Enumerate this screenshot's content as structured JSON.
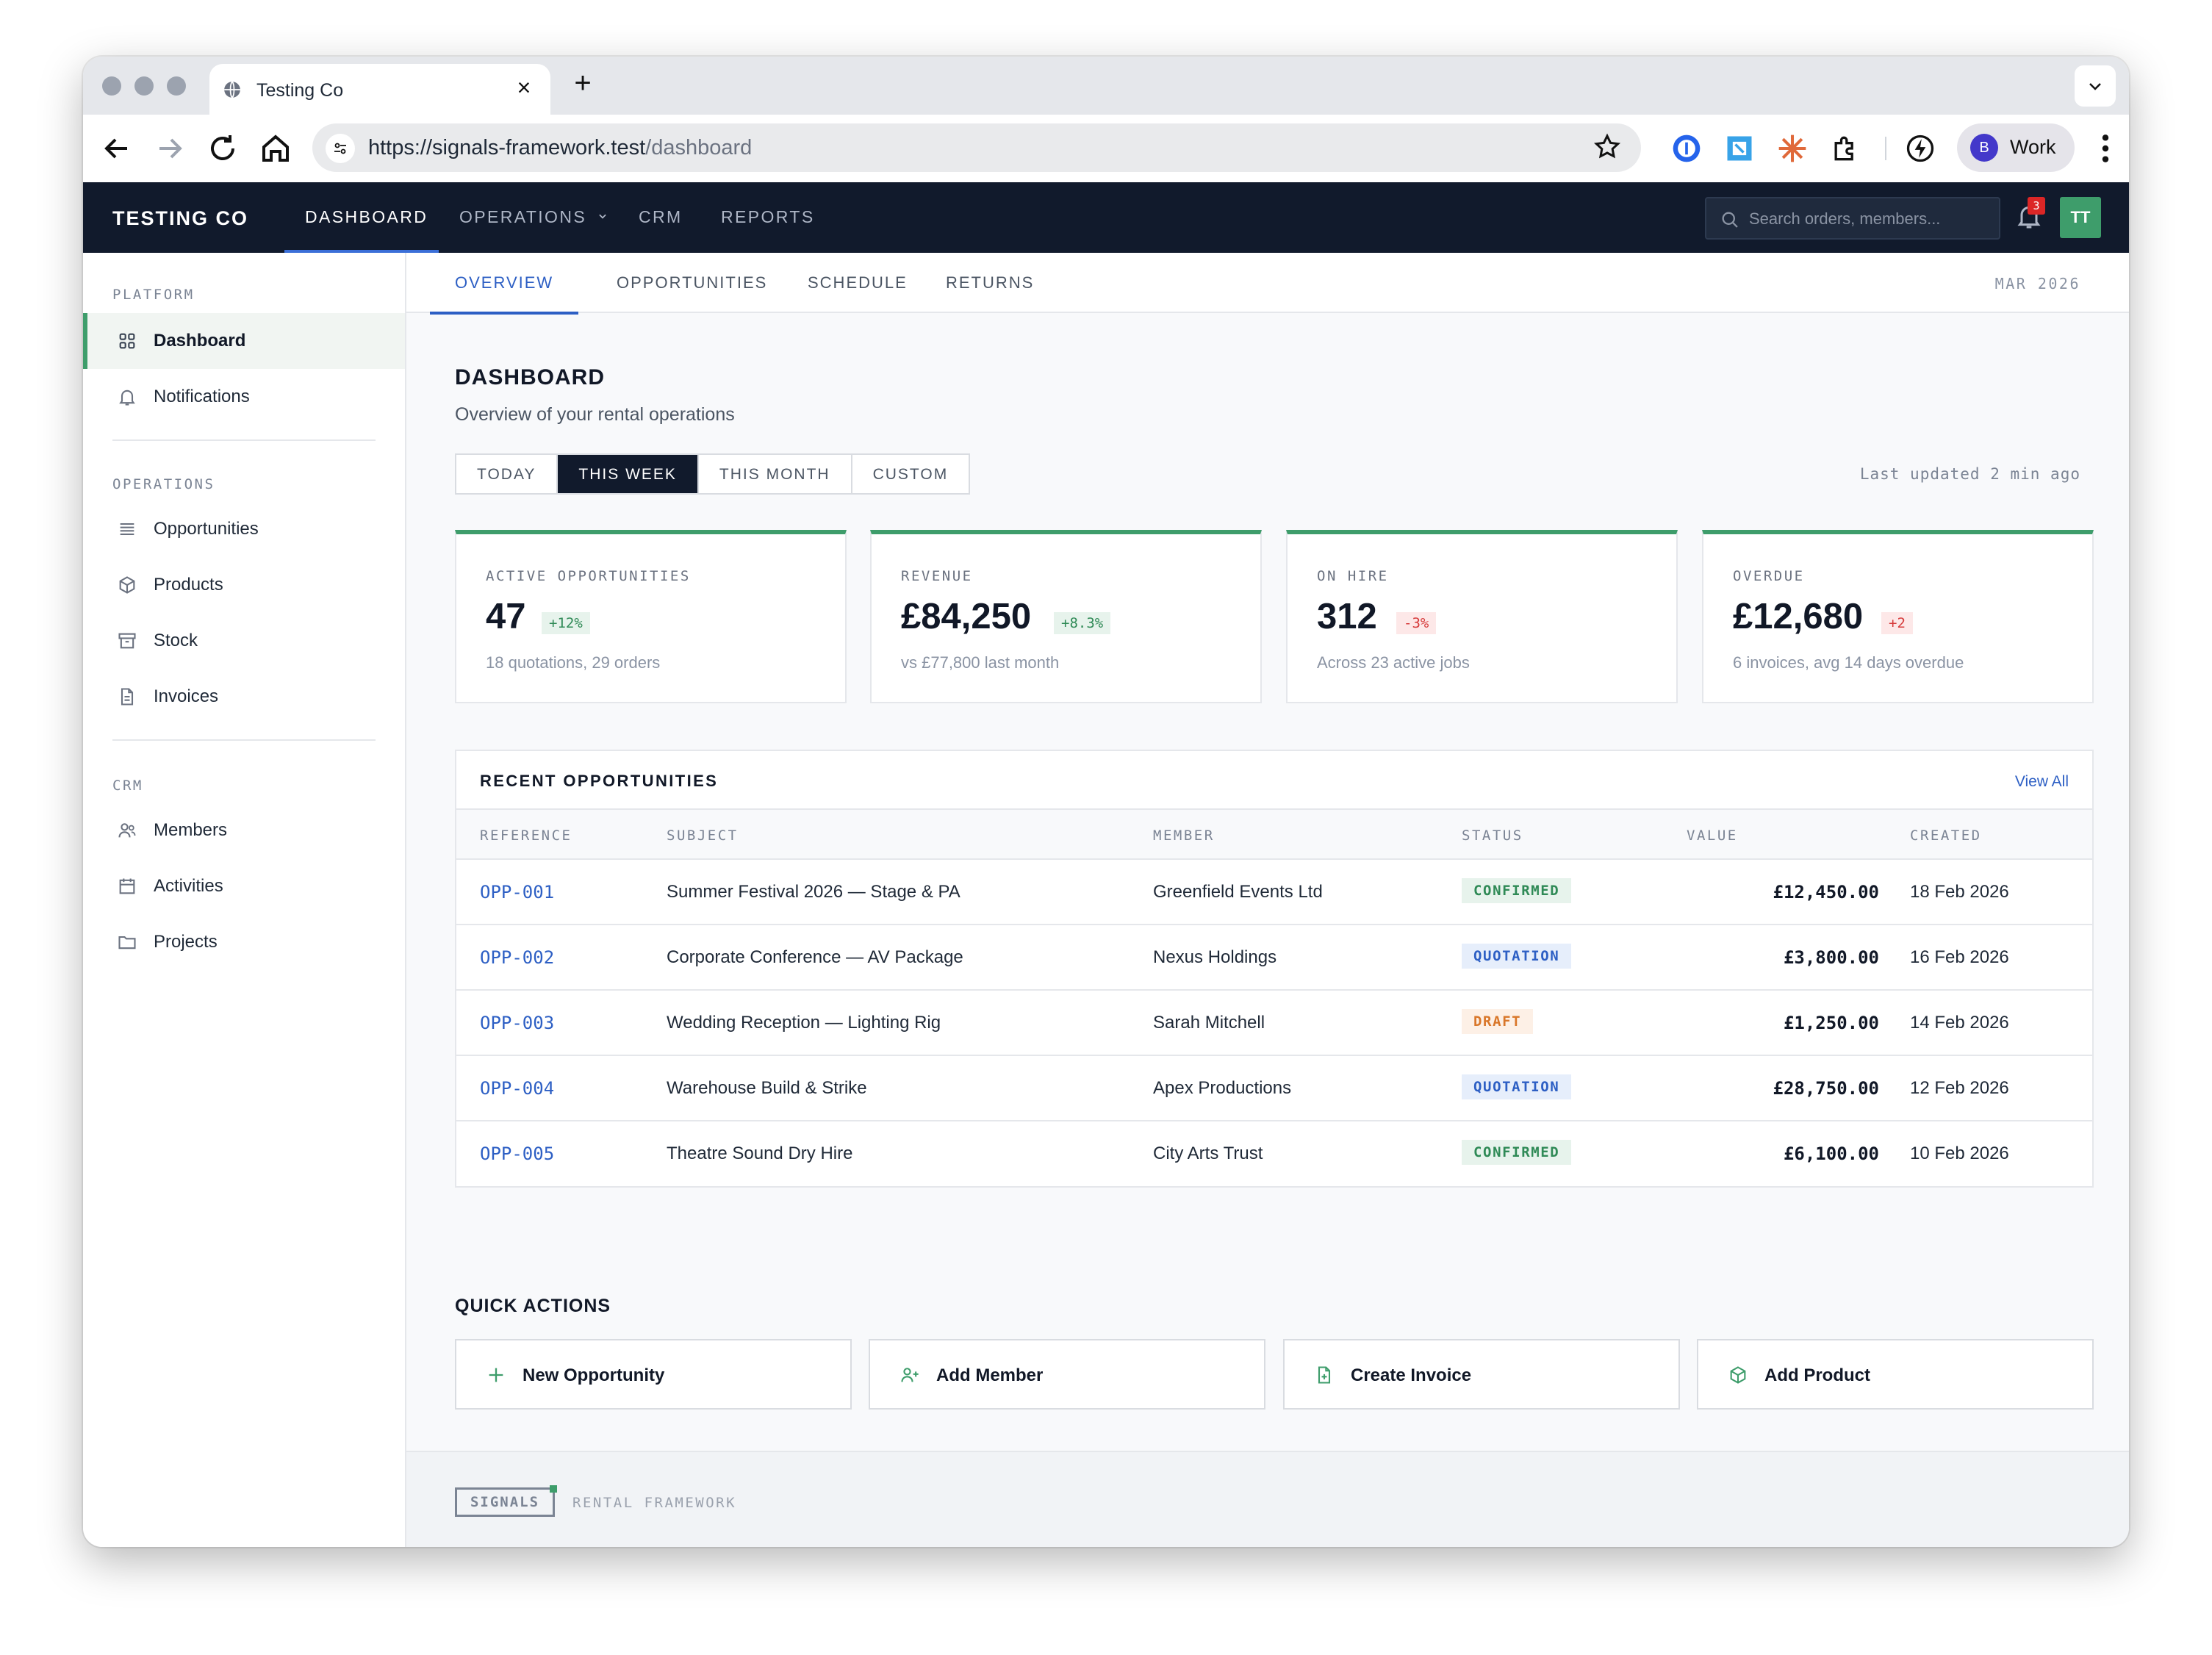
{
  "browser": {
    "tab_title": "Testing Co",
    "new_tab_glyph": "+",
    "close_glyph": "×",
    "url_host": "https://signals-framework.test",
    "url_path": "/dashboard",
    "profile_initial": "B",
    "profile_name": "Work"
  },
  "header": {
    "brand": "TESTING CO",
    "nav": [
      {
        "label": "DASHBOARD",
        "active": true
      },
      {
        "label": "OPERATIONS",
        "active": false,
        "has_dropdown": true
      },
      {
        "label": "CRM",
        "active": false
      },
      {
        "label": "REPORTS",
        "active": false
      }
    ],
    "search_placeholder": "Search orders, members...",
    "notification_count": "3",
    "user_initials": "TT"
  },
  "sidebar": {
    "groups": [
      {
        "label": "PLATFORM",
        "items": [
          {
            "label": "Dashboard",
            "icon": "grid-icon",
            "active": true
          },
          {
            "label": "Notifications",
            "icon": "bell-icon",
            "active": false
          }
        ]
      },
      {
        "label": "OPERATIONS",
        "items": [
          {
            "label": "Opportunities",
            "icon": "list-icon"
          },
          {
            "label": "Products",
            "icon": "cube-icon"
          },
          {
            "label": "Stock",
            "icon": "archive-icon"
          },
          {
            "label": "Invoices",
            "icon": "document-icon"
          }
        ]
      },
      {
        "label": "CRM",
        "items": [
          {
            "label": "Members",
            "icon": "users-icon"
          },
          {
            "label": "Activities",
            "icon": "calendar-icon"
          },
          {
            "label": "Projects",
            "icon": "folder-icon"
          }
        ]
      }
    ]
  },
  "subtabs": [
    {
      "label": "OVERVIEW",
      "active": true
    },
    {
      "label": "OPPORTUNITIES",
      "active": false
    },
    {
      "label": "SCHEDULE",
      "active": false
    },
    {
      "label": "RETURNS",
      "active": false
    }
  ],
  "period": "MAR 2026",
  "page": {
    "title": "DASHBOARD",
    "subtitle": "Overview of your rental operations",
    "ranges": [
      {
        "label": "TODAY",
        "active": false
      },
      {
        "label": "THIS WEEK",
        "active": true
      },
      {
        "label": "THIS MONTH",
        "active": false
      },
      {
        "label": "CUSTOM",
        "active": false
      }
    ],
    "last_updated": "Last updated 2 min ago"
  },
  "kpis": [
    {
      "label": "ACTIVE OPPORTUNITIES",
      "value": "47",
      "delta": "+12%",
      "trend": "positive",
      "note": "18 quotations, 29 orders"
    },
    {
      "label": "REVENUE",
      "value": "£84,250",
      "delta": "+8.3%",
      "trend": "positive",
      "note": "vs £77,800 last month"
    },
    {
      "label": "ON HIRE",
      "value": "312",
      "delta": "-3%",
      "trend": "negative",
      "note": "Across 23 active jobs"
    },
    {
      "label": "OVERDUE",
      "value": "£12,680",
      "delta": "+2",
      "trend": "negative",
      "note": "6 invoices, avg 14 days overdue"
    }
  ],
  "recent": {
    "title": "RECENT OPPORTUNITIES",
    "view_all": "View All",
    "columns": [
      "REFERENCE",
      "SUBJECT",
      "MEMBER",
      "STATUS",
      "VALUE",
      "CREATED"
    ],
    "rows": [
      {
        "ref": "OPP-001",
        "subject": "Summer Festival 2026 — Stage & PA",
        "member": "Greenfield Events Ltd",
        "status": "CONFIRMED",
        "value": "£12,450.00",
        "created": "18 Feb 2026"
      },
      {
        "ref": "OPP-002",
        "subject": "Corporate Conference — AV Package",
        "member": "Nexus Holdings",
        "status": "QUOTATION",
        "value": "£3,800.00",
        "created": "16 Feb 2026"
      },
      {
        "ref": "OPP-003",
        "subject": "Wedding Reception — Lighting Rig",
        "member": "Sarah Mitchell",
        "status": "DRAFT",
        "value": "£1,250.00",
        "created": "14 Feb 2026"
      },
      {
        "ref": "OPP-004",
        "subject": "Warehouse Build & Strike",
        "member": "Apex Productions",
        "status": "QUOTATION",
        "value": "£28,750.00",
        "created": "12 Feb 2026"
      },
      {
        "ref": "OPP-005",
        "subject": "Theatre Sound Dry Hire",
        "member": "City Arts Trust",
        "status": "CONFIRMED",
        "value": "£6,100.00",
        "created": "10 Feb 2026"
      }
    ]
  },
  "quick_actions": {
    "title": "QUICK ACTIONS",
    "items": [
      {
        "label": "New Opportunity",
        "icon": "plus-icon"
      },
      {
        "label": "Add Member",
        "icon": "user-plus-icon"
      },
      {
        "label": "Create Invoice",
        "icon": "file-plus-icon"
      },
      {
        "label": "Add Product",
        "icon": "cube-icon"
      }
    ]
  },
  "footer": {
    "badge": "SIGNALS",
    "note": "RENTAL FRAMEWORK"
  },
  "colors": {
    "header_bg": "#111a2c",
    "accent_green": "#3e9d6b",
    "link_blue": "#2d5fc4",
    "negative_red": "#d63b3b",
    "draft_orange": "#d9772a"
  }
}
